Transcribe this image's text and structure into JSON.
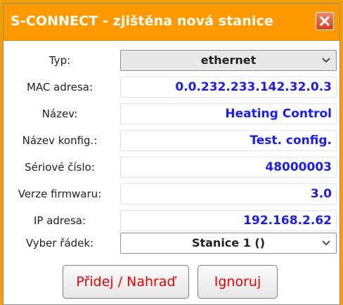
{
  "dialog": {
    "title": "S-CONNECT - zjištěna nová stanice",
    "close_icon": "close-icon",
    "accent_color": "#ff9900"
  },
  "fields": {
    "typ": {
      "label": "Typ:",
      "value": "ethernet"
    },
    "mac": {
      "label": "MAC adresa:",
      "value": "0.0.232.233.142.32.0.3"
    },
    "nazev": {
      "label": "Název:",
      "value": "Heating Control"
    },
    "nazev_konfig": {
      "label": "Název konfig.:",
      "value": "Test. config."
    },
    "seriove_cislo": {
      "label": "Sériové číslo:",
      "value": "48000003"
    },
    "verze_firmwaru": {
      "label": "Verze firmwaru:",
      "value": "3.0"
    },
    "ip_adresa": {
      "label": "IP adresa:",
      "value": "192.168.2.62"
    },
    "vyber_radek": {
      "label": "Vyber řádek:",
      "value": "Stanice 1 ()"
    }
  },
  "buttons": {
    "add_replace": "Přidej / Nahraď",
    "ignore": "Ignoruj"
  }
}
